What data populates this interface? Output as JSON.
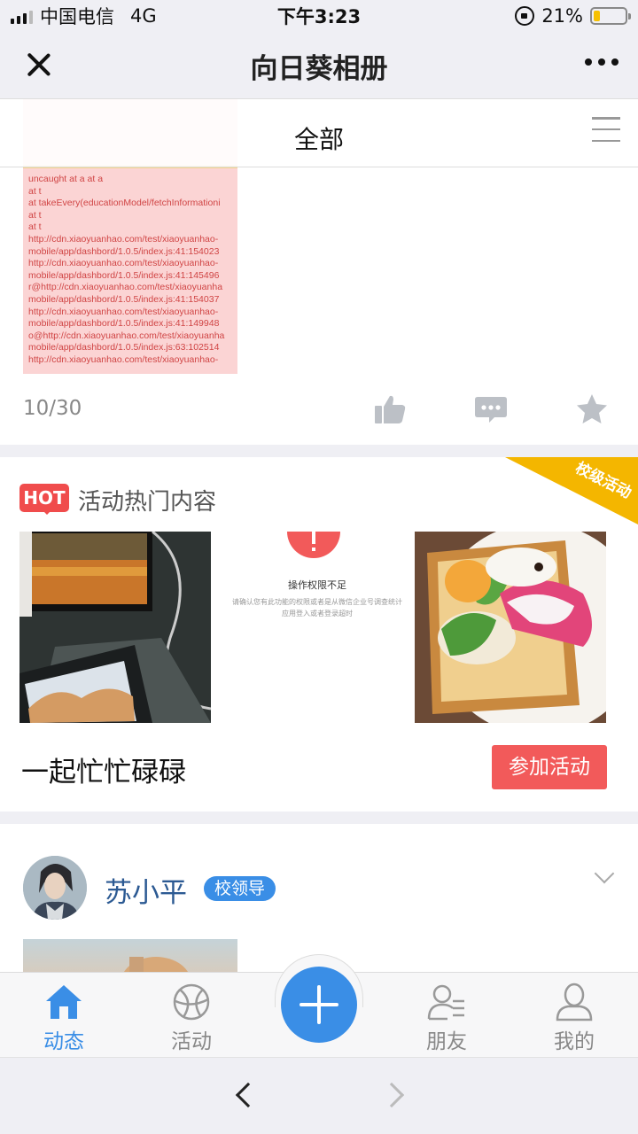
{
  "status_bar": {
    "carrier": "中国电信",
    "network": "4G",
    "time": "下午3:23",
    "battery": "21%",
    "battery_level": 0.21
  },
  "nav": {
    "title": "向日葵相册"
  },
  "filter": {
    "label": "全部"
  },
  "post1": {
    "error_text": "uncaught at a at a\nat t\nat takeEvery(educationModel/fetchInformationi\nat t\nat t\nhttp://cdn.xiaoyuanhao.com/test/xiaoyuanhao-\nmobile/app/dashbord/1.0.5/index.js:41:154023\nhttp://cdn.xiaoyuanhao.com/test/xiaoyuanhao-\nmobile/app/dashbord/1.0.5/index.js:41:145496\nr@http://cdn.xiaoyuanhao.com/test/xiaoyuanha\nmobile/app/dashbord/1.0.5/index.js:41:154037\nhttp://cdn.xiaoyuanhao.com/test/xiaoyuanhao-\nmobile/app/dashbord/1.0.5/index.js:41:149948\no@http://cdn.xiaoyuanhao.com/test/xiaoyuanha\nmobile/app/dashbord/1.0.5/index.js:63:102514\nhttp://cdn.xiaoyuanhao.com/test/xiaoyuanhao-",
    "counter": "10/30"
  },
  "hot": {
    "badge": "HOT",
    "title": "活动热门内容",
    "ribbon": "校级活动",
    "permission_title": "操作权限不足",
    "permission_desc": "请确认您有此功能的权限或者是从微信企业号调查统计应用登入或者登录超时",
    "activity_name": "一起忙忙碌碌",
    "join_button": "参加活动"
  },
  "post2": {
    "username": "苏小平",
    "role": "校领导"
  },
  "tabs": [
    {
      "label": "动态"
    },
    {
      "label": "活动"
    },
    {
      "label": "朋友"
    },
    {
      "label": "我的"
    }
  ],
  "colors": {
    "accent": "#3a8ee6",
    "hot": "#f04c4c",
    "ribbon": "#f4b600",
    "join": "#f25a5a"
  }
}
